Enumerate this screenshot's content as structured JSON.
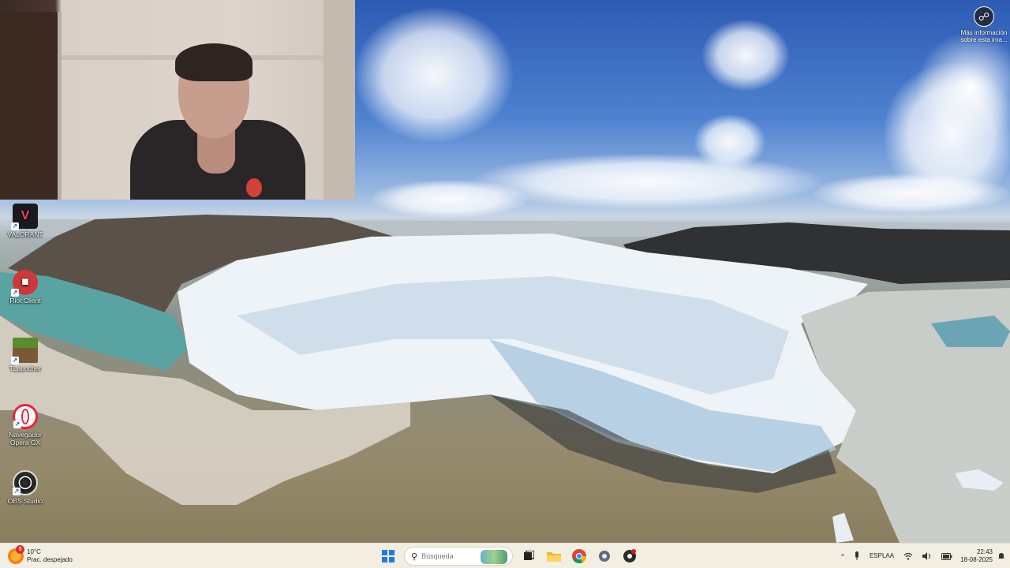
{
  "desktop": {
    "icons": [
      {
        "label": "VALORANT",
        "icon": "valorant-icon",
        "color": "#1b1b1f",
        "accent": "#fd4556"
      },
      {
        "label": "Riot Client",
        "icon": "riot-client-icon",
        "color": "#d13639",
        "accent": "#ffffff"
      },
      {
        "label": "TLauncher",
        "icon": "minecraft-block-icon",
        "color": "#5b8a2f",
        "accent": "#7a5a35"
      },
      {
        "label": "Navegador\nOpera GX",
        "icon": "opera-gx-icon",
        "color": "#ffffff",
        "accent": "#e8243e"
      },
      {
        "label": "OBS Studio",
        "icon": "obs-studio-icon",
        "color": "#2a2a2a",
        "accent": "#ffffff"
      }
    ],
    "wallpaper_info": {
      "label": "Más información sobre esta ima...",
      "icon": "camera-info-icon"
    }
  },
  "taskbar": {
    "weather": {
      "temp": "10°C",
      "condition": "Prac. despejado",
      "badge": "3"
    },
    "search": {
      "placeholder": "Búsqueda"
    },
    "pinned": [
      {
        "name": "start-button",
        "icon": "windows-logo-icon"
      },
      {
        "name": "task-view-button",
        "icon": "task-view-icon"
      },
      {
        "name": "file-explorer-button",
        "icon": "folder-icon"
      },
      {
        "name": "chrome-button",
        "icon": "chrome-icon"
      },
      {
        "name": "settings-button",
        "icon": "gear-icon"
      },
      {
        "name": "obs-taskbar-button",
        "icon": "obs-record-icon"
      }
    ],
    "tray": {
      "chevron": "^",
      "language_top": "ESP",
      "language_bottom": "LAA",
      "time": "22:43",
      "date": "18-08-2025"
    }
  }
}
